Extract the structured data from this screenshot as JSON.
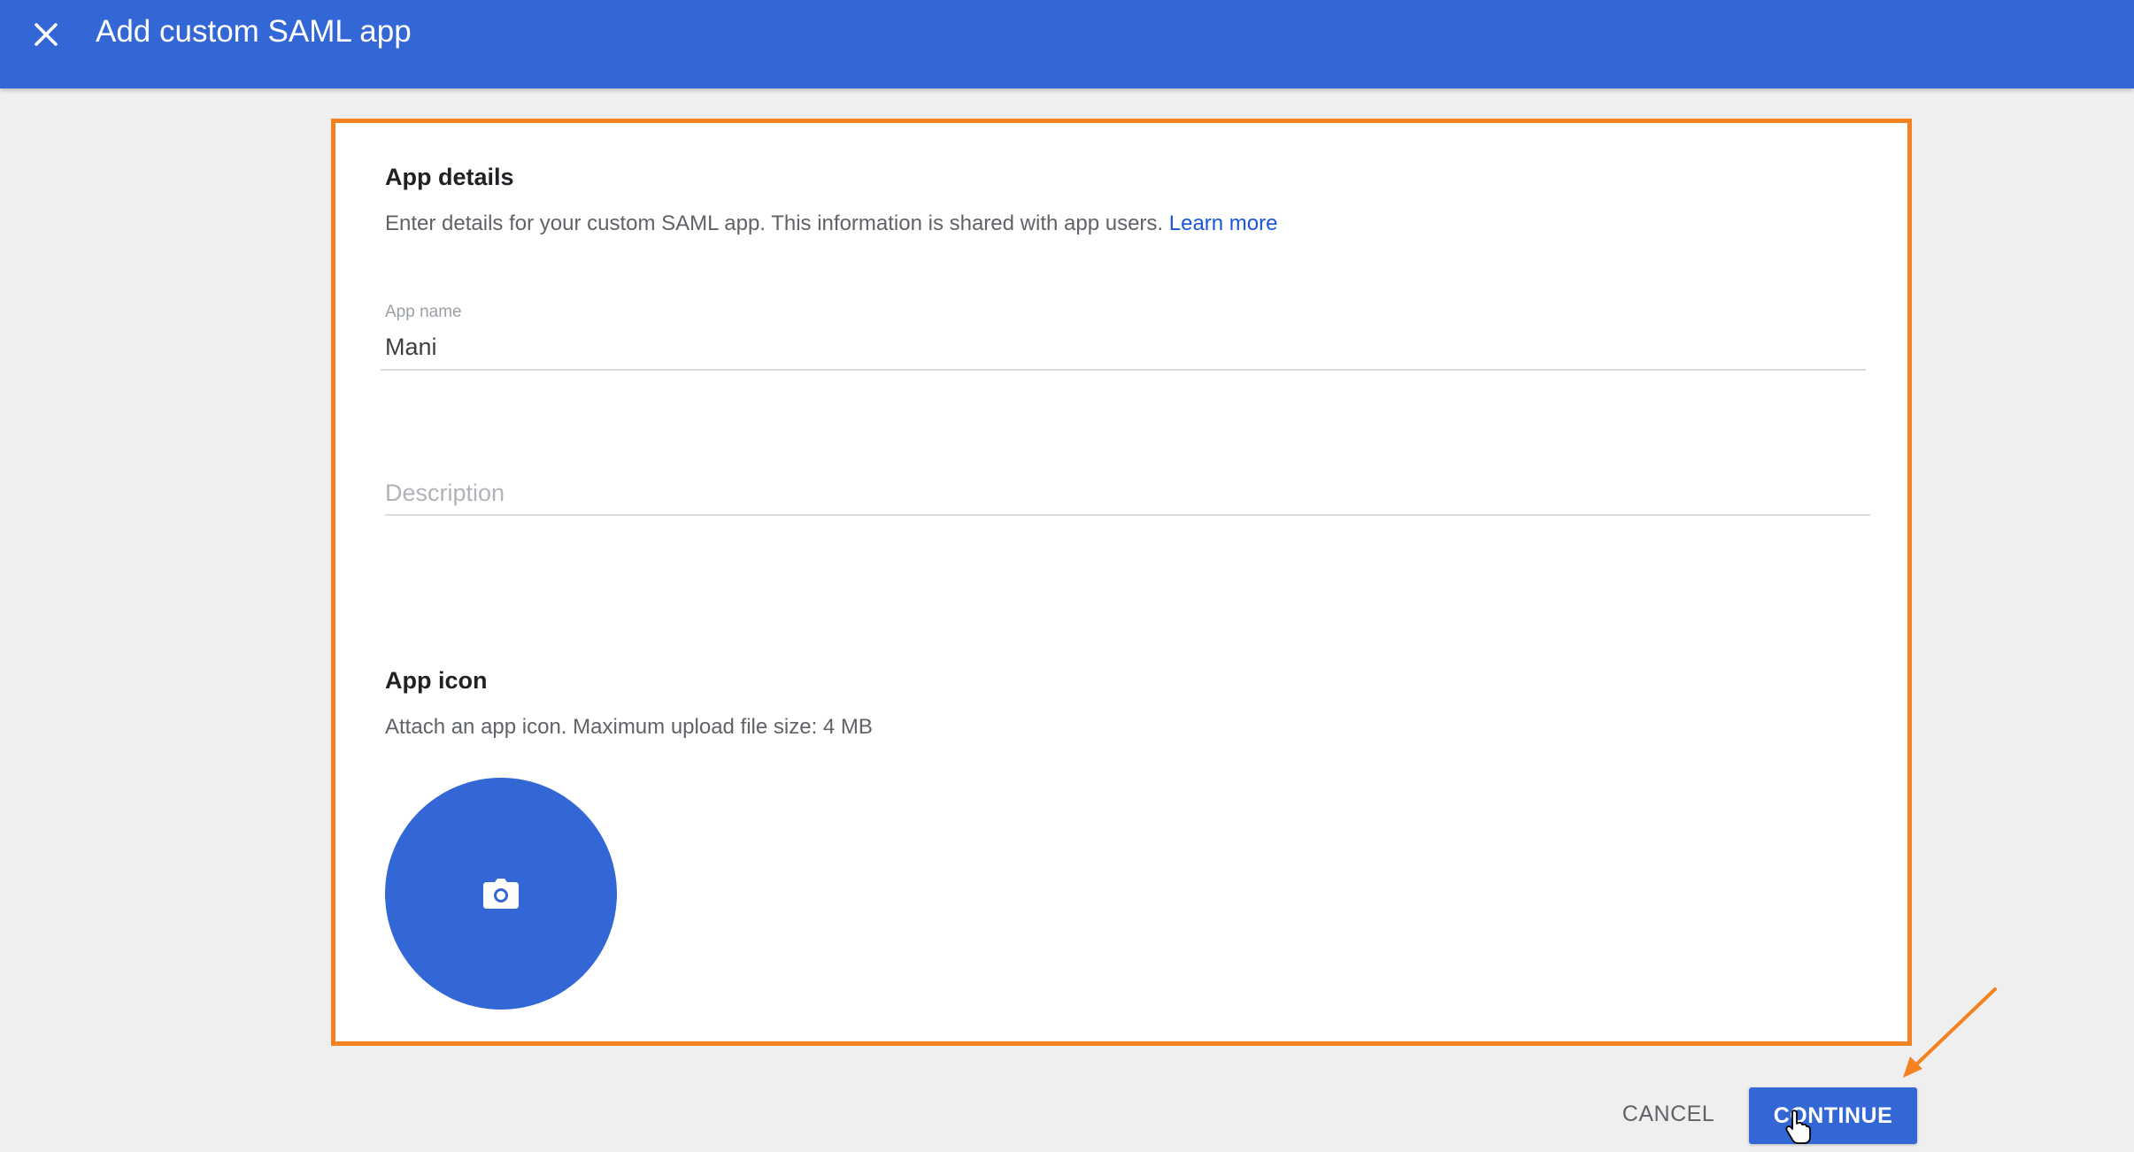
{
  "header": {
    "title": "Add custom SAML app",
    "close_icon": "close-icon",
    "background": "#3367d6"
  },
  "app_details": {
    "title": "App details",
    "description": "Enter details for your custom SAML app. This information is shared with app users.",
    "learn_more": "Learn more",
    "fields": {
      "app_name": {
        "label": "App name",
        "value": "Mani"
      },
      "description": {
        "placeholder": "Description",
        "value": ""
      }
    }
  },
  "app_icon": {
    "title": "App icon",
    "description": "Attach an app icon. Maximum upload file size: 4 MB",
    "upload_icon": "camera-icon"
  },
  "footer": {
    "cancel_label": "CANCEL",
    "continue_label": "CONTINUE"
  },
  "colors": {
    "accent": "#3367d6",
    "highlight": "#f58220",
    "link": "#1a56db"
  }
}
